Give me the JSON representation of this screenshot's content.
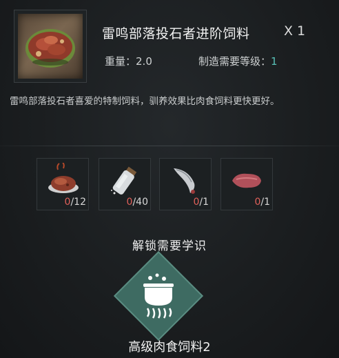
{
  "item": {
    "name": "雷鸣部落投石者进阶饲料",
    "quantity": "X 1",
    "weight_label": "重量：",
    "weight_value": "2.0",
    "level_label": "制造需要等级：",
    "level_value": "1",
    "description": "雷鸣部落投石者喜爱的特制饲料，驯养效果比肉食饲料更快更好。",
    "icon": "meat-feed-icon"
  },
  "materials": [
    {
      "icon": "cooked-meat-icon",
      "have": "0",
      "need": "/12"
    },
    {
      "icon": "salt-bottle-icon",
      "have": "0",
      "need": "/40"
    },
    {
      "icon": "fang-icon",
      "have": "0",
      "need": "/1"
    },
    {
      "icon": "raw-liver-icon",
      "have": "0",
      "need": "/1"
    }
  ],
  "unlock": {
    "title": "解锁需要学识",
    "recipe_name": "高级肉食饲料2",
    "icon": "cauldron-icon"
  },
  "colors": {
    "level_value": "#58c2b8",
    "missing_count": "#e0605a",
    "diamond_fill": "#3e6b62"
  }
}
